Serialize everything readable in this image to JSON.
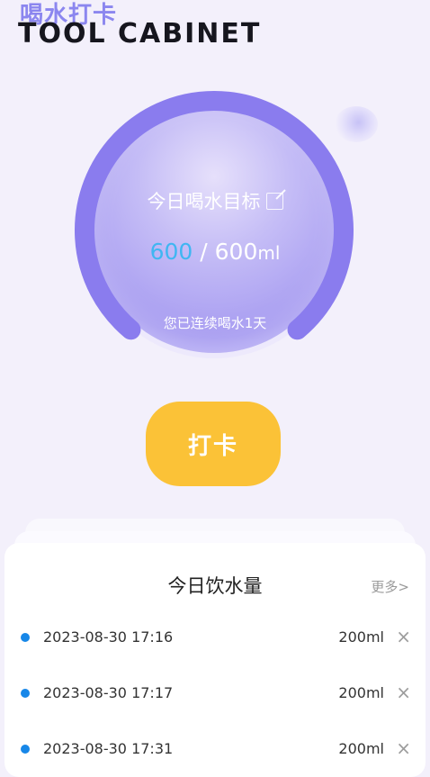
{
  "header": {
    "title_cn": "喝水打卡",
    "title_en": "TOOL CABINET"
  },
  "goal": {
    "label": "今日喝水目标",
    "edit_icon": "edit-icon",
    "current": "600",
    "separator": " / ",
    "target": "600",
    "unit": "ml",
    "progress_fraction": 1.0,
    "streak_text": "您已连续喝水1天"
  },
  "checkin": {
    "label": "打卡"
  },
  "today_card": {
    "title": "今日饮水量",
    "more_label": "更多>",
    "records": [
      {
        "time": "2023-08-30 17:16",
        "amount": "200ml",
        "delete_icon": "×"
      },
      {
        "time": "2023-08-30 17:17",
        "amount": "200ml",
        "delete_icon": "×"
      },
      {
        "time": "2023-08-30 17:31",
        "amount": "200ml",
        "delete_icon": "×"
      }
    ]
  },
  "colors": {
    "background": "#f3f0fb",
    "ring": "#8a7cee",
    "current_amount": "#3fb6f2",
    "button": "#fbc237",
    "dot": "#1787e8"
  }
}
